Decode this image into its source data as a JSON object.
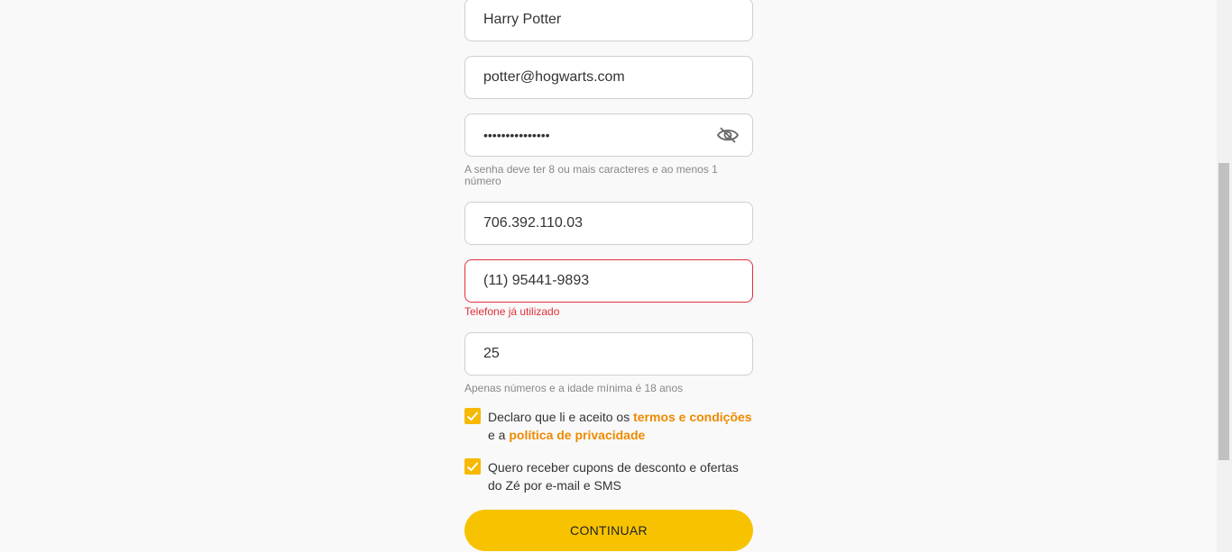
{
  "form": {
    "name_value": "Harry Potter",
    "email_value": "potter@hogwarts.com",
    "password_value": "•••••••••••••••",
    "password_hint": "A senha deve ter 8 ou mais caracteres e ao menos 1 número",
    "cpf_value": "706.392.110.03",
    "phone_value": "(11) 95441-9893",
    "phone_error": "Telefone já utilizado",
    "age_value": "25",
    "age_hint": "Apenas números e a idade mínima é 18 anos",
    "terms": {
      "checked": true,
      "text_before": "Declaro que li e aceito os ",
      "terms_link": "termos e condições",
      "text_middle": " e a ",
      "privacy_link": "política de privacidade"
    },
    "coupons": {
      "checked": true,
      "text": "Quero receber cupons de desconto e ofertas do Zé por e-mail e SMS"
    },
    "continue_label": "CONTINUAR"
  },
  "colors": {
    "accent": "#f7c300",
    "checkbox": "#f7b900",
    "link": "#ee8a00",
    "error": "#e0303a"
  },
  "icons": {
    "password_toggle": "eye-slash-icon",
    "checkbox_mark": "check-icon"
  }
}
